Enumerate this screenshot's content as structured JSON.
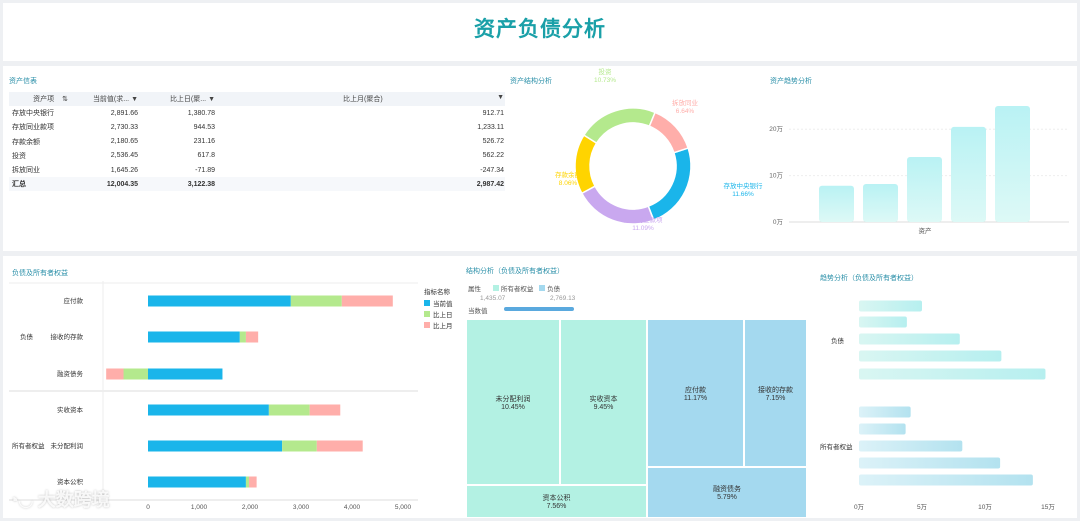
{
  "header": {
    "title": "资产负债分析"
  },
  "asset_table": {
    "title": "资产信表",
    "columns": [
      "资产项",
      "当前值(求...",
      "比上日(聚...",
      "比上月(聚合)"
    ],
    "rows": [
      [
        "存放中央银行",
        "2,891.66",
        "1,380.78",
        "912.71"
      ],
      [
        "存放同业款项",
        "2,730.33",
        "944.53",
        "1,233.11"
      ],
      [
        "存款余额",
        "2,180.65",
        "231.16",
        "526.72"
      ],
      [
        "投资",
        "2,536.45",
        "617.8",
        "562.22"
      ],
      [
        "拆放同业",
        "1,645.26",
        "-71.89",
        "-247.34"
      ]
    ],
    "total": [
      "汇总",
      "12,004.35",
      "3,122.38",
      "2,987.42"
    ]
  },
  "structure": {
    "title": "资产结构分析",
    "slices": [
      {
        "name": "存放中央银行",
        "pct": "11.66%",
        "value": 11.66,
        "color": "#1ab5ea"
      },
      {
        "name": "存放同业款项",
        "pct": "11.09%",
        "value": 11.09,
        "color": "#c9a8ef"
      },
      {
        "name": "存款余额",
        "pct": "8.06%",
        "value": 8.06,
        "color": "#ffd400"
      },
      {
        "name": "投资",
        "pct": "10.73%",
        "value": 10.73,
        "color": "#b4e98d"
      },
      {
        "name": "拆放同业",
        "pct": "6.64%",
        "value": 6.64,
        "color": "#ffaeaa"
      }
    ]
  },
  "trend": {
    "title": "资产趋势分析",
    "yticks": [
      "20万",
      "10万",
      "0万"
    ],
    "xlabel": "资产",
    "chart_data": {
      "type": "bar",
      "categories": [
        "资产"
      ],
      "values": [
        7.8,
        8.2,
        14,
        20.5,
        25
      ],
      "ylim": [
        0,
        25
      ]
    }
  },
  "liab": {
    "title": "负债及所有者权益",
    "groups": [
      "负债",
      "所有者权益"
    ],
    "legend_title": "指标名称",
    "legend": [
      "当前值",
      "比上日",
      "比上月"
    ],
    "colors": [
      "#1ab5ea",
      "#b4e98d",
      "#ffaeaa"
    ],
    "xticks": [
      "0",
      "1,000",
      "2,000",
      "3,000",
      "4,000",
      "5,000"
    ],
    "chart_data": {
      "type": "bar",
      "categories": [
        "应付款",
        "接收的存款",
        "融资债务",
        "实收资本",
        "未分配利润",
        "资本公积"
      ],
      "series": [
        {
          "name": "当前值",
          "values": [
            2800,
            1800,
            1460,
            2370,
            2630,
            1920
          ]
        },
        {
          "name": "比上日",
          "values": [
            1000,
            120,
            -480,
            800,
            680,
            60
          ]
        },
        {
          "name": "比上月",
          "values": [
            1000,
            240,
            -340,
            600,
            900,
            150
          ]
        }
      ],
      "xlim": [
        0,
        5000
      ]
    }
  },
  "treemap": {
    "title": "结构分析（负债及所有者权益）",
    "attr_label": "属性",
    "legend": [
      "所有者权益",
      "负债"
    ],
    "range": [
      "1,435.07",
      "2,769.13"
    ],
    "value_label": "当数值",
    "cells": [
      {
        "name": "未分配利润",
        "pct": "10.45%"
      },
      {
        "name": "实收资本",
        "pct": "9.45%"
      },
      {
        "name": "资本公积",
        "pct": "7.56%"
      },
      {
        "name": "应付款",
        "pct": "11.17%"
      },
      {
        "name": "接收的存款",
        "pct": "7.15%"
      },
      {
        "name": "融资债务",
        "pct": "5.79%"
      }
    ]
  },
  "trend2": {
    "title": "趋势分析（负债及所有者权益）",
    "groups": [
      "负债",
      "所有者权益"
    ],
    "xticks": [
      "0万",
      "5万",
      "10万",
      "15万"
    ],
    "chart_data": {
      "type": "bar",
      "series": [
        {
          "name": "负债",
          "values": [
            5,
            3.8,
            8,
            11.3,
            14.8
          ]
        },
        {
          "name": "所有者权益",
          "values": [
            4.1,
            3.7,
            8.2,
            11.2,
            13.8
          ]
        }
      ],
      "xlim": [
        0,
        15
      ]
    }
  },
  "watermark": "大数跨境"
}
